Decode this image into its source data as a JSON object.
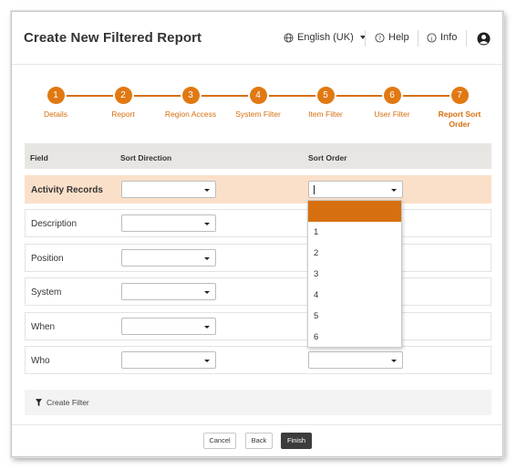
{
  "header": {
    "title": "Create New Filtered Report",
    "language": "English (UK)",
    "help": "Help",
    "info": "Info"
  },
  "steps": [
    {
      "number": "1",
      "label": "Details"
    },
    {
      "number": "2",
      "label": "Report"
    },
    {
      "number": "3",
      "label": "Region Access"
    },
    {
      "number": "4",
      "label": "System Filter"
    },
    {
      "number": "5",
      "label": "Item Filter"
    },
    {
      "number": "6",
      "label": "User Filter"
    },
    {
      "number": "7",
      "label": "Report Sort Order"
    }
  ],
  "table": {
    "headers": {
      "field": "Field",
      "sort_direction": "Sort Direction",
      "sort_order": "Sort Order"
    },
    "rows": [
      {
        "label": "Activity Records"
      },
      {
        "label": "Description"
      },
      {
        "label": "Position"
      },
      {
        "label": "System"
      },
      {
        "label": "When"
      },
      {
        "label": "Who"
      }
    ]
  },
  "sort_order_options": [
    "",
    "1",
    "2",
    "3",
    "4",
    "5",
    "6"
  ],
  "create_filter": "Create Filter",
  "footer": {
    "cancel": "Cancel",
    "back": "Back",
    "finish": "Finish"
  },
  "colors": {
    "accent": "#e07912",
    "highlight_row": "#fbe0c9",
    "finish_button": "#3c3c3c"
  }
}
